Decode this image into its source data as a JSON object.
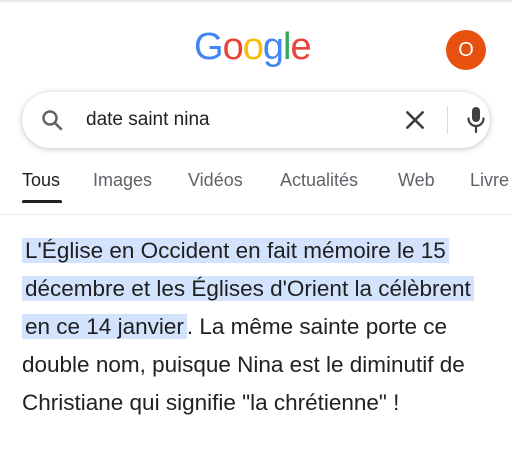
{
  "colors": {
    "google_blue": "#4285F4",
    "google_red": "#EA4335",
    "google_yellow": "#FBBC05",
    "google_green": "#34A853",
    "avatar_bg": "#E8500F",
    "highlight": "#D3E3FD"
  },
  "header": {
    "logo_letters": [
      "G",
      "o",
      "o",
      "g",
      "l",
      "e"
    ],
    "avatar_initial": "O"
  },
  "search": {
    "query": "date saint nina",
    "search_icon": "search-icon",
    "clear_icon": "close-icon",
    "voice_icon": "mic-icon"
  },
  "tabs": [
    {
      "label": "Tous",
      "active": true
    },
    {
      "label": "Images",
      "active": false
    },
    {
      "label": "Vidéos",
      "active": false
    },
    {
      "label": "Actualités",
      "active": false
    },
    {
      "label": "Web",
      "active": false
    },
    {
      "label": "Livre",
      "active": false
    }
  ],
  "snippet": {
    "highlighted": "L'Église en Occident en fait mémoire le 15 décembre et les Églises d'Orient la célèbrent en ce 14 janvier",
    "rest": ". La même sainte porte ce double nom, puisque Nina est le diminutif de Christiane qui signifie \"la chrétienne\" !"
  }
}
